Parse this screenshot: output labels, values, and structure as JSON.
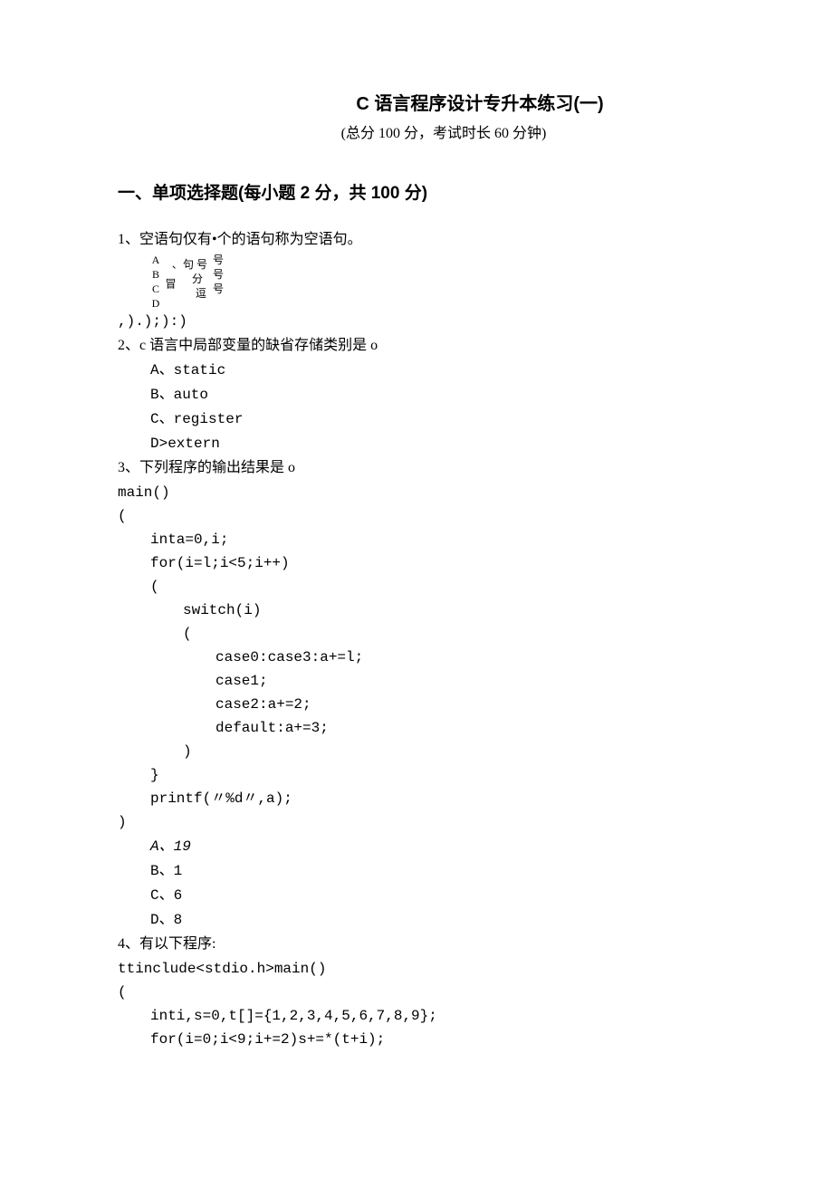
{
  "title": "C 语言程序设计专升本练习(一)",
  "subtitle": "(总分 100 分，考试时长 60 分钟)",
  "section_heading": "一、单项选择题(每小题 2 分，共 100 分)",
  "q1": {
    "stem": "1、空语句仅有•个的语句称为空语句。",
    "labels": "ABCD",
    "col1": {
      "a": "、冒",
      "b": "、",
      "c": "、",
      "d": "、"
    },
    "col2": {
      "a": "句 号",
      "b": "分",
      "c": "",
      "d": "逗"
    },
    "col3": {
      "a": "号",
      "b": "号",
      "c": "号"
    },
    "tail": ",).);):)"
  },
  "q2": {
    "stem": "2、c 语言中局部变量的缺省存储类别是 o",
    "a": "A、static",
    "b": "B、auto",
    "c": "C、register",
    "d": "D>extern"
  },
  "q3": {
    "stem": "3、下列程序的输出结果是 o",
    "code": {
      "l1": "main()",
      "l2": "(",
      "l3": "inta=0,i;",
      "l4": "for(i=l;i<5;i++)",
      "l5": "(",
      "l6": "switch(i)",
      "l7": "(",
      "l8": "case0:case3:a+=l;",
      "l9": "case1;",
      "l10": "case2:a+=2;",
      "l11": "default:a+=3;",
      "l12": ")",
      "l13": "}",
      "l14": "printf(〃%d〃,a);",
      "l15": ")"
    },
    "a": "A、19",
    "b": "B、1",
    "c": "C、6",
    "d": "D、8"
  },
  "q4": {
    "stem": "4、有以下程序:",
    "code": {
      "l1": "ttinclude<stdio.h>main()",
      "l2": "(",
      "l3": "inti,s=0,t[]={1,2,3,4,5,6,7,8,9};",
      "l4": "for(i=0;i<9;i+=2)s+=*(t+i);"
    }
  }
}
